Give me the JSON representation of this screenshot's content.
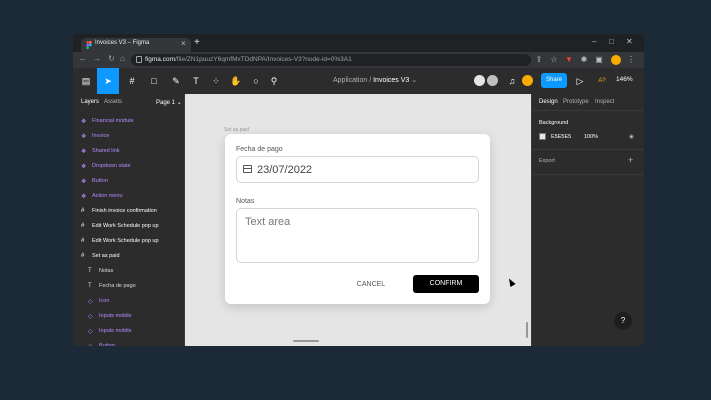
{
  "browser": {
    "tab_title": "Invoices V3 – Figma",
    "new_tab": "+",
    "url_host": "figma.com",
    "url_path": "/file/ZN1puuzY6qmfMxTDdNPA/Invoices-V3?node-id=0%3A1",
    "controls": {
      "minimize": "–",
      "maximize": "□",
      "close": "✕"
    }
  },
  "toolbar": {
    "breadcrumb_parent": "Application",
    "breadcrumb_sep": "/",
    "file_name": "Invoices V3",
    "share_label": "Share",
    "accessibility_label": "A?",
    "zoom": "146%"
  },
  "layers_panel": {
    "tab_layers": "Layers",
    "tab_assets": "Assets",
    "page": "Page 1",
    "items": [
      {
        "label": "Financial module",
        "icon": "component-icon",
        "color": "#b38cff"
      },
      {
        "label": "Invoice",
        "icon": "component-icon",
        "color": "#b38cff"
      },
      {
        "label": "Shared link",
        "icon": "component-icon",
        "color": "#b38cff"
      },
      {
        "label": "Dropdown state",
        "icon": "component-icon",
        "color": "#b38cff"
      },
      {
        "label": "Button",
        "icon": "component-icon",
        "color": "#b38cff"
      },
      {
        "label": "Action menu",
        "icon": "component-icon",
        "color": "#b38cff"
      },
      {
        "label": "Finish invoice confirmation",
        "icon": "frame-icon",
        "color": "#ffffff"
      },
      {
        "label": "Edit Work Schedule pop up",
        "icon": "frame-icon",
        "color": "#ffffff"
      },
      {
        "label": "Edit Work Schedule pop up",
        "icon": "frame-icon",
        "color": "#ffffff"
      },
      {
        "label": "Set as paid",
        "icon": "frame-icon",
        "color": "#ffffff"
      },
      {
        "label": "Notas",
        "icon": "text-icon",
        "color": "#d9d9d9"
      },
      {
        "label": "Fecha de pago",
        "icon": "text-icon",
        "color": "#d9d9d9"
      },
      {
        "label": "Icon",
        "icon": "instance-icon",
        "color": "#b38cff"
      },
      {
        "label": "Inputs mobile",
        "icon": "instance-icon",
        "color": "#b38cff"
      },
      {
        "label": "Inputs mobile",
        "icon": "instance-icon",
        "color": "#b38cff"
      },
      {
        "label": "Button",
        "icon": "instance-icon",
        "color": "#b38cff"
      }
    ]
  },
  "canvas": {
    "frame_label": "Set as paid",
    "modal": {
      "date_label": "Fecha de pago",
      "date_value": "23/07/2022",
      "notes_label": "Notas",
      "notes_placeholder": "Text area",
      "cancel_label": "CANCEL",
      "confirm_label": "CONFIRM"
    }
  },
  "design_panel": {
    "tabs": [
      "Design",
      "Prototype",
      "Inspect"
    ],
    "background_label": "Background",
    "background_hex": "E5E5E5",
    "background_opacity": "100%",
    "export_label": "Export",
    "add_label": "+",
    "help_label": "?"
  },
  "colors": {
    "accent": "#0d99ff",
    "canvas": "#e5e5e5",
    "panel": "#2c2c2c"
  }
}
